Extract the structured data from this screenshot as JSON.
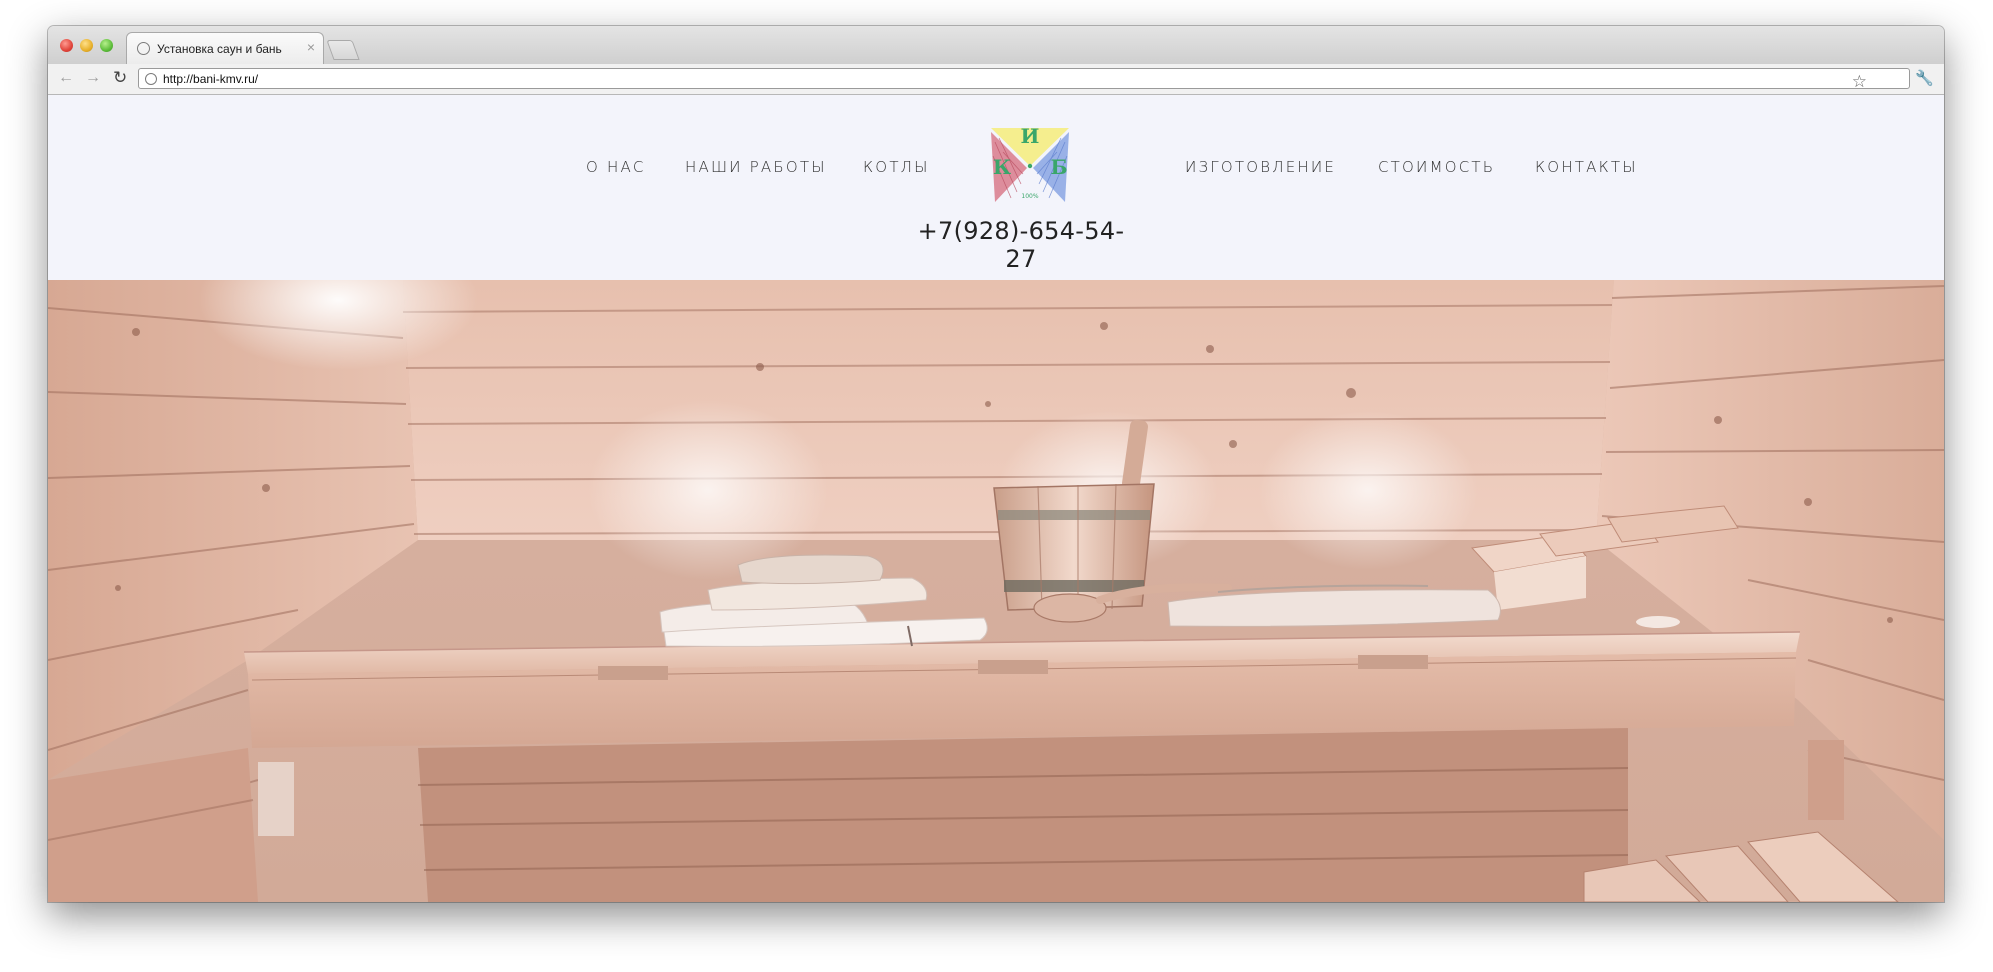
{
  "browser": {
    "tab_title": "Установка саун и бань",
    "tab_close": "×",
    "url": "http://bani-kmv.ru/",
    "back_icon": "back-arrow-icon",
    "forward_icon": "forward-arrow-icon",
    "reload_icon": "reload-icon",
    "bookmark_icon": "star-icon",
    "menu_icon": "wrench-icon"
  },
  "nav": {
    "left": [
      "О НАС",
      "НАШИ РАБОТЫ",
      "КОТЛЫ"
    ],
    "right": [
      "ИЗГОТОВЛЕНИЕ",
      "СТОИМОСТЬ",
      "КОНТАКТЫ"
    ]
  },
  "logo": {
    "letters": [
      "И",
      "К",
      "Б"
    ],
    "small_text": "100%",
    "colors": {
      "green": "#3aa66a",
      "red": "#c95a6b",
      "blue": "#6d8fd8",
      "yellow": "#f3e66a"
    }
  },
  "phone": "+7(928)-654-54-27",
  "colors": {
    "header_bg": "#f3f4fb",
    "nav_text": "#333333",
    "wood_light": "#f2d2c2",
    "wood_mid": "#dfb09c",
    "wood_dark": "#c4917d"
  }
}
